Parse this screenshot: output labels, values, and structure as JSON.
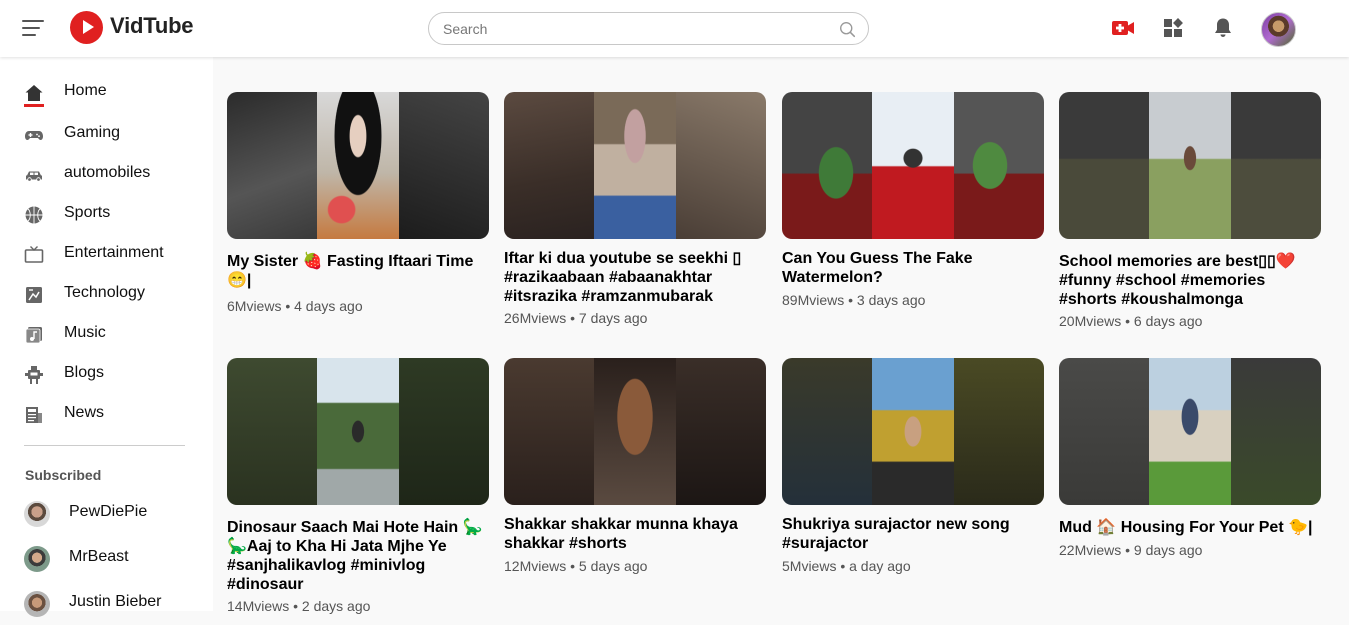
{
  "app": {
    "name": "VidTube"
  },
  "search": {
    "placeholder": "Search"
  },
  "sidebar": {
    "items": [
      {
        "label": "Home",
        "icon": "home-icon"
      },
      {
        "label": "Gaming",
        "icon": "gamepad-icon"
      },
      {
        "label": "automobiles",
        "icon": "car-icon"
      },
      {
        "label": "Sports",
        "icon": "basketball-icon"
      },
      {
        "label": "Entertainment",
        "icon": "tv-icon"
      },
      {
        "label": "Technology",
        "icon": "technology-icon"
      },
      {
        "label": "Music",
        "icon": "music-icon"
      },
      {
        "label": "Blogs",
        "icon": "blog-icon"
      },
      {
        "label": "News",
        "icon": "news-icon"
      }
    ],
    "subscribed_title": "Subscribed",
    "subscriptions": [
      {
        "name": "PewDiePie"
      },
      {
        "name": "MrBeast"
      },
      {
        "name": "Justin Bieber"
      }
    ]
  },
  "videos": [
    {
      "title": "My Sister 🍓 Fasting Iftaari Time 😁|",
      "meta": "6Mviews • 4 days ago"
    },
    {
      "title": "Iftar ki dua youtube se seekhi ▯ #razikaabaan #abaanakhtar #itsrazika #ramzanmubarak",
      "meta": "26Mviews • 7 days ago"
    },
    {
      "title": "Can You Guess The Fake Watermelon?",
      "meta": "89Mviews • 3 days ago"
    },
    {
      "title": "School memories are best▯▯❤️ #funny #school #memories #shorts #koushalmonga",
      "meta": "20Mviews • 6 days ago"
    },
    {
      "title": "Dinosaur Saach Mai Hote Hain 🦕 🦕Aaj to Kha Hi Jata Mjhe Ye #sanjhalikavlog #minivlog #dinosaur",
      "meta": "14Mviews • 2 days ago"
    },
    {
      "title": "Shakkar shakkar munna khaya shakkar #shorts",
      "meta": "12Mviews • 5 days ago"
    },
    {
      "title": "Shukriya surajactor new song #surajactor",
      "meta": "5Mviews • a day ago"
    },
    {
      "title": "Mud 🏠 Housing For Your Pet 🐤|",
      "meta": "22Mviews • 9 days ago"
    }
  ]
}
